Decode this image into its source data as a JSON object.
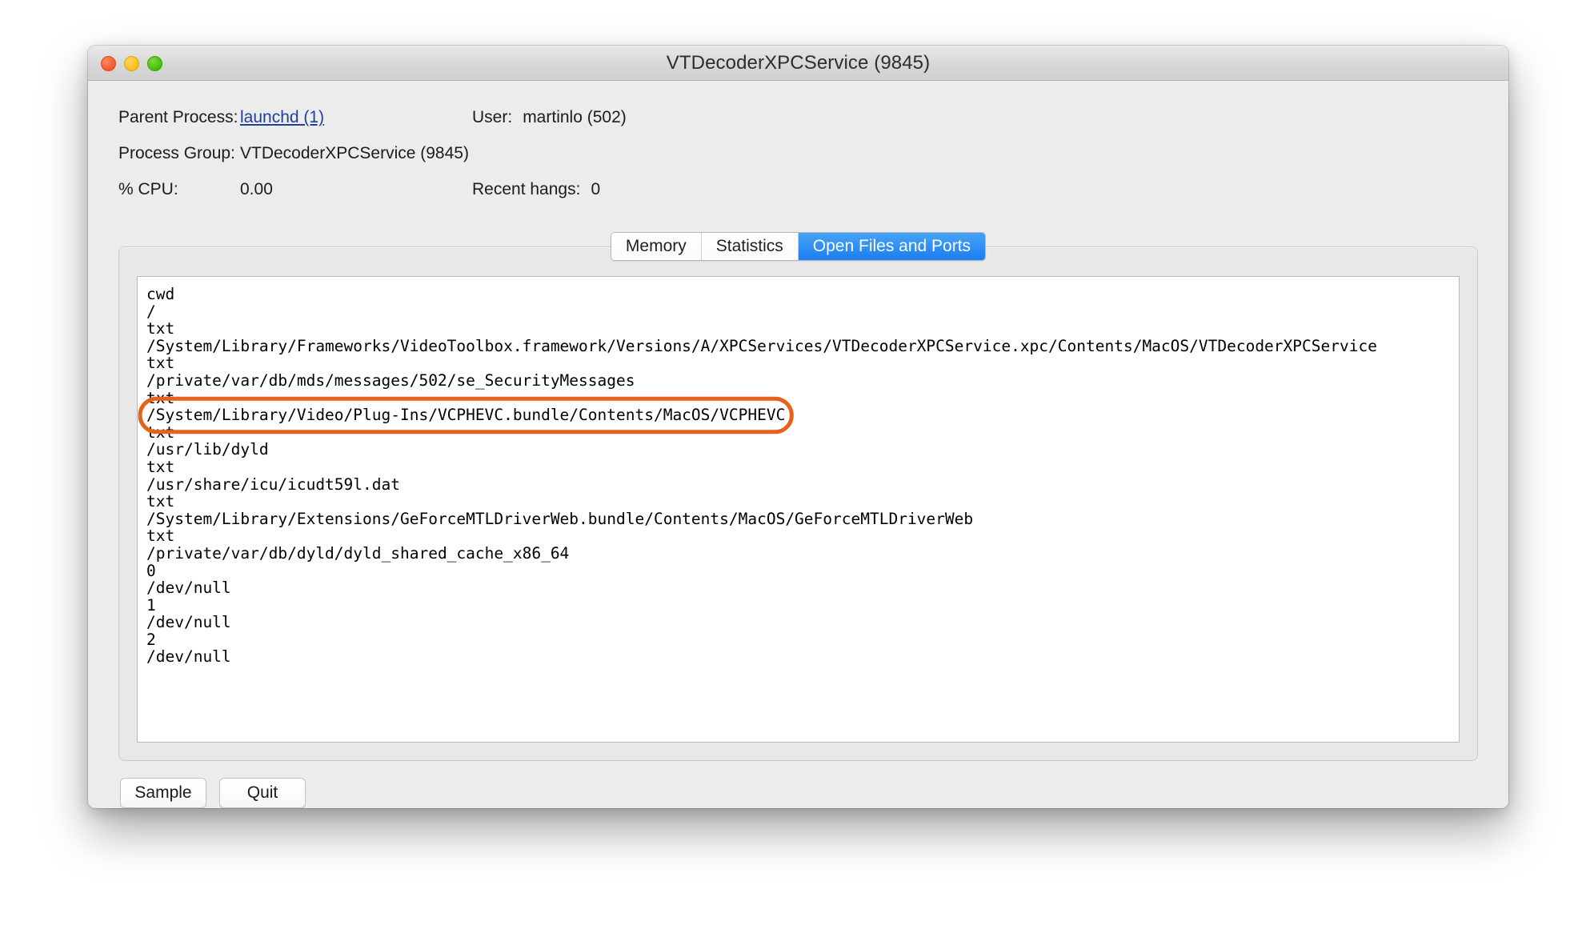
{
  "window": {
    "title": "VTDecoderXPCService (9845)",
    "traffic_lights": [
      {
        "name": "close",
        "color": "#f2562c"
      },
      {
        "name": "minimize",
        "color": "#f7bc15"
      },
      {
        "name": "maximize",
        "color": "#43bd0c"
      }
    ]
  },
  "info": {
    "parent_process_label": "Parent Process:",
    "parent_process_value": "launchd (1)",
    "user_label": "User:",
    "user_value": "martinlo (502)",
    "process_group_label": "Process Group:",
    "process_group_value": "VTDecoderXPCService (9845)",
    "cpu_label": "% CPU:",
    "cpu_value": "0.00",
    "recent_hangs_label": "Recent hangs:",
    "recent_hangs_value": "0"
  },
  "tabs": [
    {
      "label": "Memory",
      "active": false
    },
    {
      "label": "Statistics",
      "active": false
    },
    {
      "label": "Open Files and Ports",
      "active": true
    }
  ],
  "open_files": {
    "lines": [
      "cwd",
      "/",
      "txt",
      "/System/Library/Frameworks/VideoToolbox.framework/Versions/A/XPCServices/VTDecoderXPCService.xpc/Contents/MacOS/VTDecoderXPCService",
      "txt",
      "/private/var/db/mds/messages/502/se_SecurityMessages",
      "txt",
      "/System/Library/Video/Plug-Ins/VCPHEVC.bundle/Contents/MacOS/VCPHEVC",
      "txt",
      "/usr/lib/dyld",
      "txt",
      "/usr/share/icu/icudt59l.dat",
      "txt",
      "/System/Library/Extensions/GeForceMTLDriverWeb.bundle/Contents/MacOS/GeForceMTLDriverWeb",
      "txt",
      "/private/var/db/dyld/dyld_shared_cache_x86_64",
      "0",
      "/dev/null",
      "1",
      "/dev/null",
      "2",
      "/dev/null"
    ]
  },
  "annotation": {
    "shape": "ellipse-highlight",
    "color": "#e8611a",
    "stroke_width": 5,
    "target_line": "/System/Library/Video/Plug-Ins/VCPHEVC.bundle/Contents/MacOS/VCPHEVC"
  },
  "buttons": {
    "sample": "Sample",
    "quit": "Quit"
  }
}
